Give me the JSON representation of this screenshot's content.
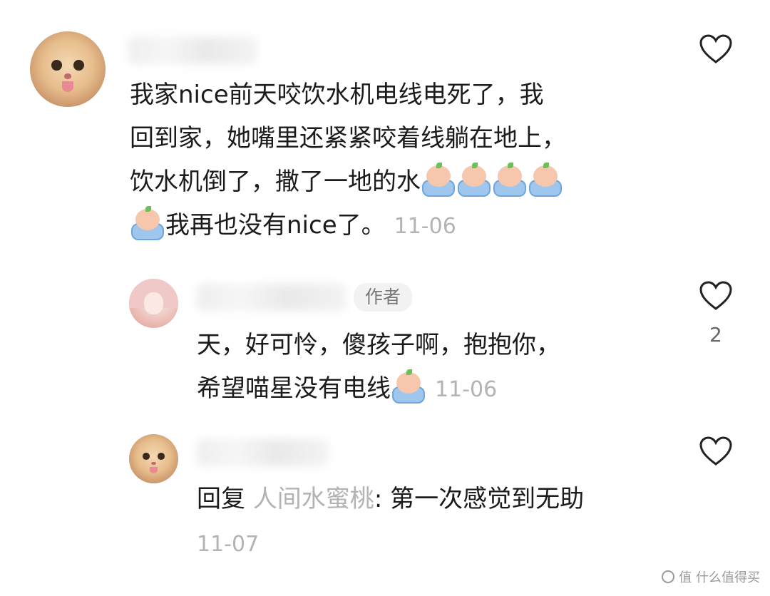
{
  "comment": {
    "lines": [
      "我家nice前天咬饮水机电线电死了，我",
      "回到家，她嘴里还紧紧咬着线躺在地上，",
      "饮水机倒了，撒了一地的水",
      "我再也没有nice了。"
    ],
    "time": "11-06",
    "emoji": "crying-emoji"
  },
  "reply1": {
    "badge": "作者",
    "lines": [
      "天，好可怜，傻孩子啊，抱抱你，",
      "希望喵星没有电线"
    ],
    "time": "11-06",
    "like_count": "2",
    "emoji": "crying-emoji"
  },
  "reply2": {
    "prefix": "回复",
    "reply_to": "人间水蜜桃",
    "colon": ":",
    "text": "第一次感觉到无助",
    "time": "11-07"
  },
  "watermark": "值 什么值得买"
}
